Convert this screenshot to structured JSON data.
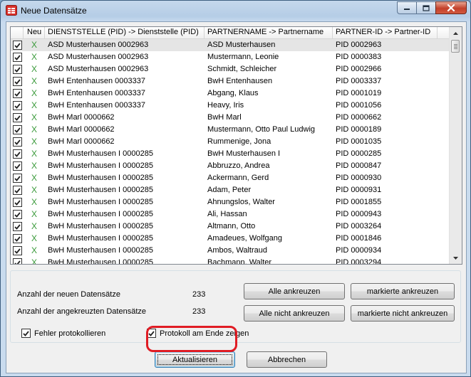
{
  "window": {
    "title": "Neue Datensätze",
    "icons": {
      "app": "table-app-icon",
      "minimize": "minimize-icon",
      "maximize": "maximize-icon",
      "close": "close-icon"
    }
  },
  "grid": {
    "columns": [
      "Neu",
      "DIENSTSTELLE (PID) -> Dienststelle (PID)",
      "PARTNERNAME -> Partnername",
      "PARTNER-ID -> Partner-ID"
    ],
    "rows": [
      {
        "dienststelle": "ASD Musterhausen 0002963",
        "partnername": "ASD Musterhausen",
        "partner_id": "PID 0002963"
      },
      {
        "dienststelle": "ASD Musterhausen 0002963",
        "partnername": "Mustermann, Leonie",
        "partner_id": "PID 0000383"
      },
      {
        "dienststelle": "ASD Musterhausen 0002963",
        "partnername": "Schmidt, Schleicher",
        "partner_id": "PID 0002966"
      },
      {
        "dienststelle": "BwH Entenhausen 0003337",
        "partnername": "BwH Entenhausen",
        "partner_id": "PID 0003337"
      },
      {
        "dienststelle": "BwH Entenhausen 0003337",
        "partnername": "Abgang, Klaus",
        "partner_id": "PID 0001019"
      },
      {
        "dienststelle": "BwH Entenhausen 0003337",
        "partnername": "Heavy, Iris",
        "partner_id": "PID 0001056"
      },
      {
        "dienststelle": "BwH Marl 0000662",
        "partnername": "BwH Marl",
        "partner_id": "PID 0000662"
      },
      {
        "dienststelle": "BwH Marl 0000662",
        "partnername": "Mustermann, Otto Paul Ludwig",
        "partner_id": "PID 0000189"
      },
      {
        "dienststelle": "BwH Marl 0000662",
        "partnername": "Rummenige, Jona",
        "partner_id": "PID 0001035"
      },
      {
        "dienststelle": "BwH Musterhausen I 0000285",
        "partnername": "BwH Musterhausen I",
        "partner_id": "PID 0000285"
      },
      {
        "dienststelle": "BwH Musterhausen I 0000285",
        "partnername": "Abbruzzo, Andrea",
        "partner_id": "PID 0000847"
      },
      {
        "dienststelle": "BwH Musterhausen I 0000285",
        "partnername": "Ackermann, Gerd",
        "partner_id": "PID 0000930"
      },
      {
        "dienststelle": "BwH Musterhausen I 0000285",
        "partnername": "Adam, Peter",
        "partner_id": "PID 0000931"
      },
      {
        "dienststelle": "BwH Musterhausen I 0000285",
        "partnername": "Ahnungslos, Walter",
        "partner_id": "PID 0001855"
      },
      {
        "dienststelle": "BwH Musterhausen I 0000285",
        "partnername": "Ali, Hassan",
        "partner_id": "PID 0000943"
      },
      {
        "dienststelle": "BwH Musterhausen I 0000285",
        "partnername": "Altmann, Otto",
        "partner_id": "PID 0003264"
      },
      {
        "dienststelle": "BwH Musterhausen I 0000285",
        "partnername": "Amadeues, Wolfgang",
        "partner_id": "PID 0001846"
      },
      {
        "dienststelle": "BwH Musterhausen I 0000285",
        "partnername": "Ambos, Waltraud",
        "partner_id": "PID 0000934"
      },
      {
        "dienststelle": "BwH Musterhausen I 0000285",
        "partnername": "Bachmann, Walter",
        "partner_id": "PID 0003294"
      }
    ],
    "new_mark": "X",
    "check_icon": "checkmark-icon"
  },
  "summary": {
    "new_label": "Anzahl der neuen Datensätze",
    "new_count": "233",
    "checked_label": "Anzahl der angekreuzten Datensätze",
    "checked_count": "233"
  },
  "buttons": {
    "check_all": "Alle ankreuzen",
    "check_marked": "markierte ankreuzen",
    "uncheck_all": "Alle nicht ankreuzen",
    "uncheck_marked": "markierte nicht ankreuzen",
    "refresh": "Aktualisieren",
    "cancel": "Abbrechen"
  },
  "options": {
    "log_errors": "Fehler protokollieren",
    "show_log": "Protokoll am Ende zeigen"
  },
  "colors": {
    "highlight": "#e01c24",
    "new_mark": "#3a9a3a",
    "selected_row": "#e5e5e5"
  }
}
